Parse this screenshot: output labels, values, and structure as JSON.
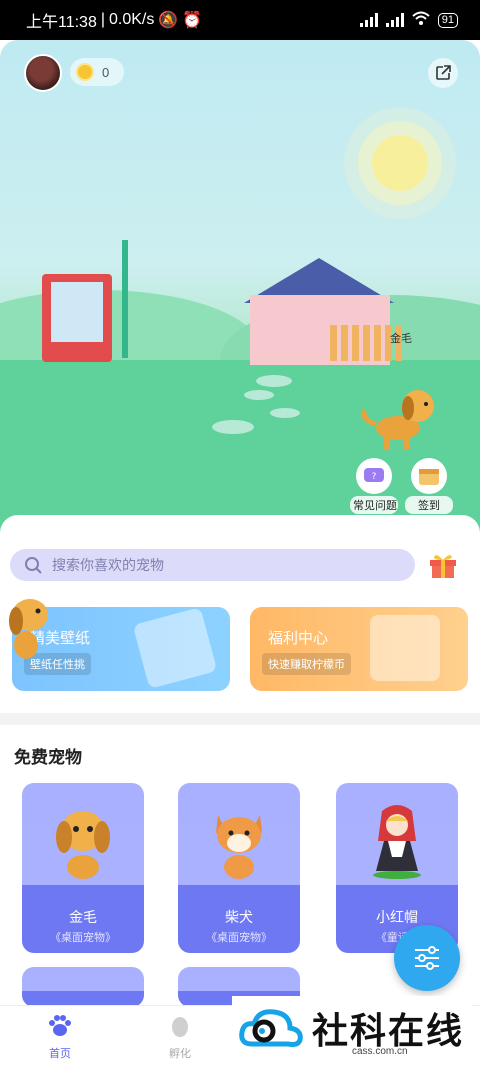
{
  "status_bar": {
    "time": "上午11:38",
    "speed": "0.0K/s",
    "battery": "91"
  },
  "header": {
    "coin_count": "0"
  },
  "scene": {
    "pet_label": "金毛",
    "faq_label": "常见问题",
    "signin_label": "签到"
  },
  "search": {
    "placeholder": "搜索你喜欢的宠物"
  },
  "banners": [
    {
      "title": "精美壁纸",
      "subtitle": "壁纸任性挑"
    },
    {
      "title": "福利中心",
      "subtitle": "快速赚取柠檬币"
    }
  ],
  "free_pets": {
    "title": "免费宠物",
    "items": [
      {
        "name": "金毛",
        "tag": "《桌面宠物》"
      },
      {
        "name": "柴犬",
        "tag": "《桌面宠物》"
      },
      {
        "name": "小红帽",
        "tag": "《童话..."
      }
    ]
  },
  "bottom_nav": {
    "home": "首页",
    "hatch": "孵化"
  },
  "watermark": {
    "text": "社科在线",
    "url": "cass.com.cn"
  },
  "colors": {
    "accent": "#5b66f0",
    "card": "#6f78f3",
    "fab": "#2fa8f0"
  }
}
